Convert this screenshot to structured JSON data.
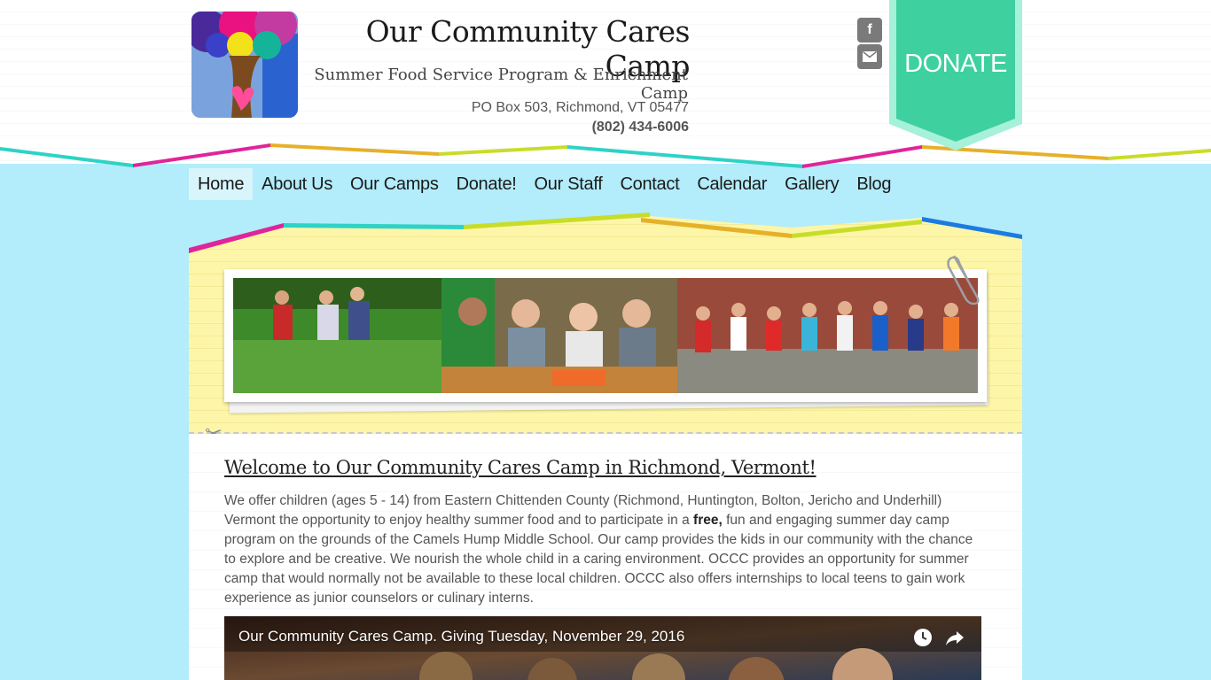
{
  "header": {
    "title": "Our Community Cares Camp",
    "subtitle": "Summer Food Service Program & Enrichment Camp",
    "address": "PO Box 503, Richmond, VT 05477",
    "phone": "(802) 434-6006",
    "social": {
      "facebook_icon": "facebook-icon",
      "email_icon": "mail-icon",
      "facebook_glyph": "f"
    },
    "donate_label": "DONATE"
  },
  "nav": {
    "items": [
      "Home",
      "About Us",
      "Our Camps",
      "Donate!",
      "Our Staff",
      "Contact",
      "Calendar",
      "Gallery",
      "Blog"
    ],
    "active": "Home"
  },
  "main": {
    "welcome_heading": "Welcome to Our Community Cares Camp in Richmond, Vermont!",
    "intro_before_bold": "We offer children (ages 5 - 14) from Eastern Chittenden County (Richmond, Huntington, Bolton, Jericho and Underhill) Vermont the opportunity to enjoy healthy summer food and to participate in a ",
    "intro_bold": "free,",
    "intro_after_bold": " fun and engaging summer day camp program on the grounds of the Camels Hump Middle School. Our camp provides the kids in our community with the chance to explore and be creative. We nourish the whole child in a caring environment. OCCC provides an opportunity for summer camp that would normally not be available to these local children. OCCC also offers internships to local teens to gain work experience as junior counselors or culinary interns.",
    "video_title": "Our Community Cares Camp. Giving Tuesday, November 29, 2016"
  },
  "colors": {
    "sky": "#b3ecfb",
    "paper_yellow": "#fdf6a8",
    "donate_green": "#3fd0a0",
    "tape_teal": "#2ed3c5",
    "tape_magenta": "#e0249a",
    "tape_yellow": "#c8dd28",
    "tape_orange": "#e6b029",
    "tape_blue": "#1b7be0"
  }
}
